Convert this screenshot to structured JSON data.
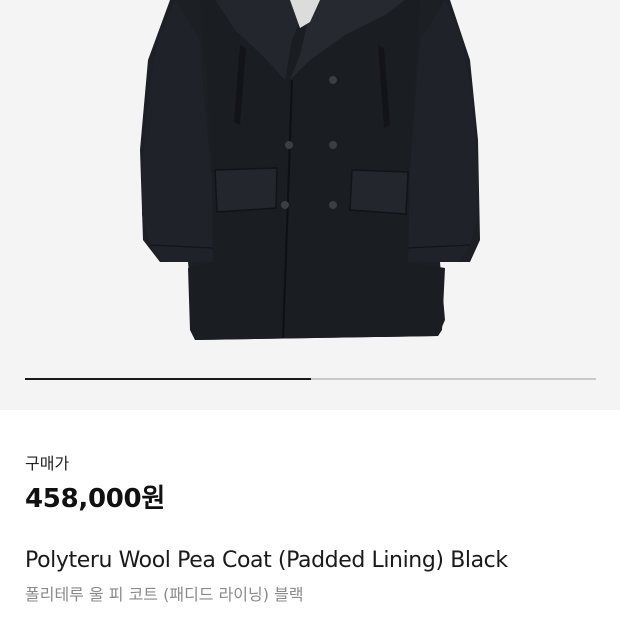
{
  "product": {
    "image_alt_icon": "coat-image",
    "carousel_progress": 0.5,
    "price_label": "구매가",
    "price": "458,000원",
    "name_en": "Polyteru Wool Pea Coat (Padded Lining) Black",
    "name_ko": "폴리테루 울 피 코트 (패디드 라이닝) 블랙"
  },
  "colors": {
    "coat": "#1c1f24",
    "image_bg": "#f4f4f4",
    "progress_fill": "#1a1a1a",
    "progress_track": "#c9c9c9",
    "subtitle": "#8a8a8a"
  }
}
